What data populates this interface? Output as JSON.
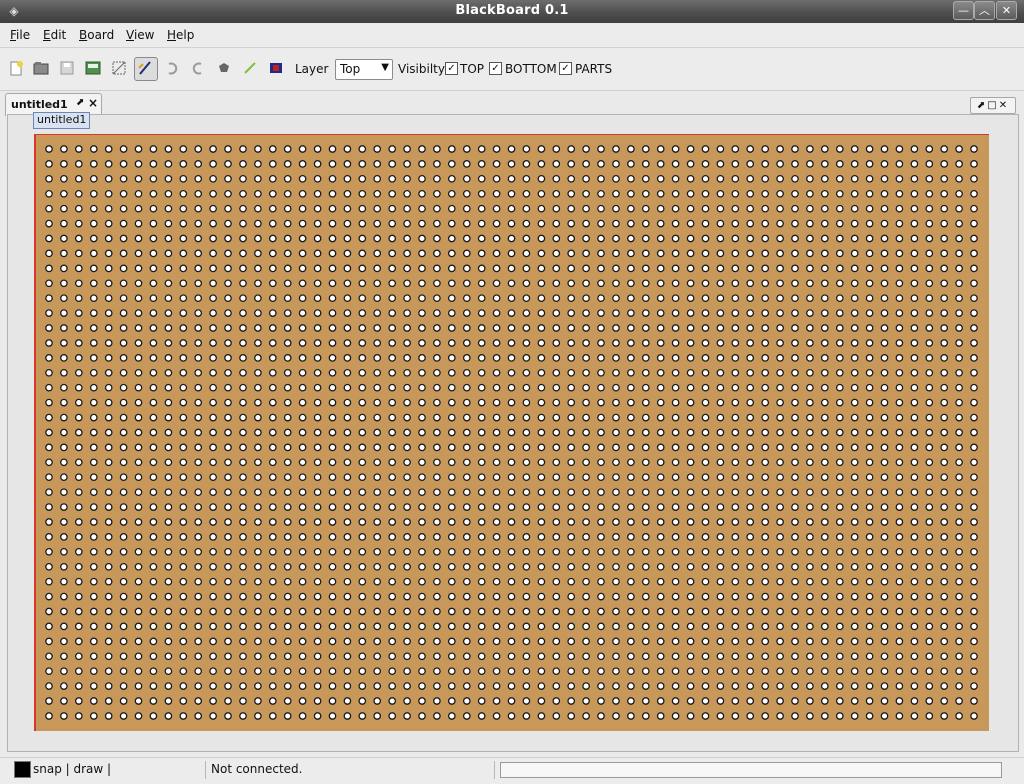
{
  "window": {
    "title": "BlackBoard 0.1"
  },
  "menu": {
    "items": [
      {
        "u": "F",
        "rest": "ile"
      },
      {
        "u": "E",
        "rest": "dit"
      },
      {
        "u": "B",
        "rest": "oard"
      },
      {
        "u": "V",
        "rest": "iew"
      },
      {
        "u": "H",
        "rest": "elp"
      }
    ]
  },
  "toolbar": {
    "buttons": [
      "new-icon",
      "open-icon",
      "save-icon",
      "export-icon",
      "select-icon",
      "draw-icon",
      "undo-icon",
      "redo-icon",
      "rotate-icon",
      "probe-icon",
      "color-icon"
    ],
    "layer_label": "Layer",
    "layer_value": "Top",
    "visibility_label": "Visibilty",
    "checks": [
      {
        "label": "TOP",
        "checked": true
      },
      {
        "label": "BOTTOM",
        "checked": true
      },
      {
        "label": "PARTS",
        "checked": true
      }
    ]
  },
  "tab": {
    "label": "untitled1",
    "tooltip": "untitled1"
  },
  "board": {
    "rows": 39,
    "cols": 63,
    "color": "#c8985a",
    "outline": "#d23a2a"
  },
  "status": {
    "mode": "snap | draw |",
    "connection": "Not connected."
  }
}
